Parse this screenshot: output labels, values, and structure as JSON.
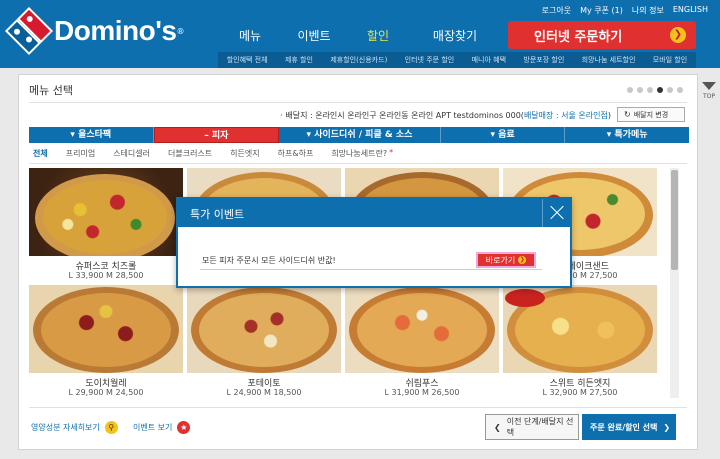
{
  "header": {
    "brand": "Domino's",
    "reg_mark": "®",
    "util_links": [
      "로그아웃",
      "My 쿠폰 (1)",
      "나의 정보",
      "ENGLISH"
    ],
    "nav": [
      "메뉴",
      "이벤트",
      "할인",
      "매장찾기"
    ],
    "order_button": "인터넷 주문하기",
    "subnav": [
      "할인혜택 전체",
      "제휴 할인",
      "제휴할인(신용카드)",
      "인터넷 주문 할인",
      "매니아 혜택",
      "방문포장 할인",
      "희망나눔 세트할인",
      "모바일 할인"
    ]
  },
  "page_scroll": {
    "label": "TOP"
  },
  "panel": {
    "title": "메뉴 선택",
    "carousel_dots": 6,
    "active_dot": 4,
    "address_prefix": "· 배달지 : 온라인시 온라인구 온라인동 온라인 APT testdominos 000(",
    "address_store": "배달매장 : 서울 온라인점",
    "address_suffix": ")",
    "address_change": "배달지 변경",
    "categories": [
      "올스타팩",
      "피자",
      "사이드디쉬 / 피클 & 소스",
      "음료",
      "특가메뉴"
    ],
    "category_prefixes": [
      "▾",
      "–",
      "▾",
      "▾",
      "▾"
    ],
    "selected_category": 1,
    "filters": [
      "전체",
      "프리미엄",
      "스테디셀러",
      "더블크러스트",
      "히든엣지",
      "하프&하프",
      "희망나눔세트란?"
    ],
    "filter_star": "*",
    "pizzas": [
      {
        "name": "슈퍼스코 치즈롤",
        "price": "L 33,900 M 28,500"
      },
      {
        "name": "",
        "price": ""
      },
      {
        "name": "",
        "price": ""
      },
      {
        "name": "치즈케이크샌드",
        "price": "L 32,900 M 27,500"
      },
      {
        "name": "도이치월레",
        "price": "L 29,900 M 24,500"
      },
      {
        "name": "포테이토",
        "price": "L 24,900 M 18,500"
      },
      {
        "name": "쉬림푸스",
        "price": "L 31,900 M 26,500"
      },
      {
        "name": "스위트 히든엣지",
        "price": "L 32,900 M 27,500"
      }
    ],
    "nutrition_link": "영양성분 자세히보기",
    "event_link": "이벤트 보기",
    "prev_button": "이전 단계/배달지 선택",
    "next_button": "주문 완료/할인 선택"
  },
  "modal": {
    "title": "특가 이벤트",
    "message": "모든 피자 주문시 모든 사이드디쉬 반값!",
    "button": "바로가기"
  },
  "colors": {
    "brand_blue": "#0e6fae",
    "brand_red": "#e0302f",
    "accent_yellow": "#f7c11c",
    "nav_active": "#e6e94a"
  }
}
